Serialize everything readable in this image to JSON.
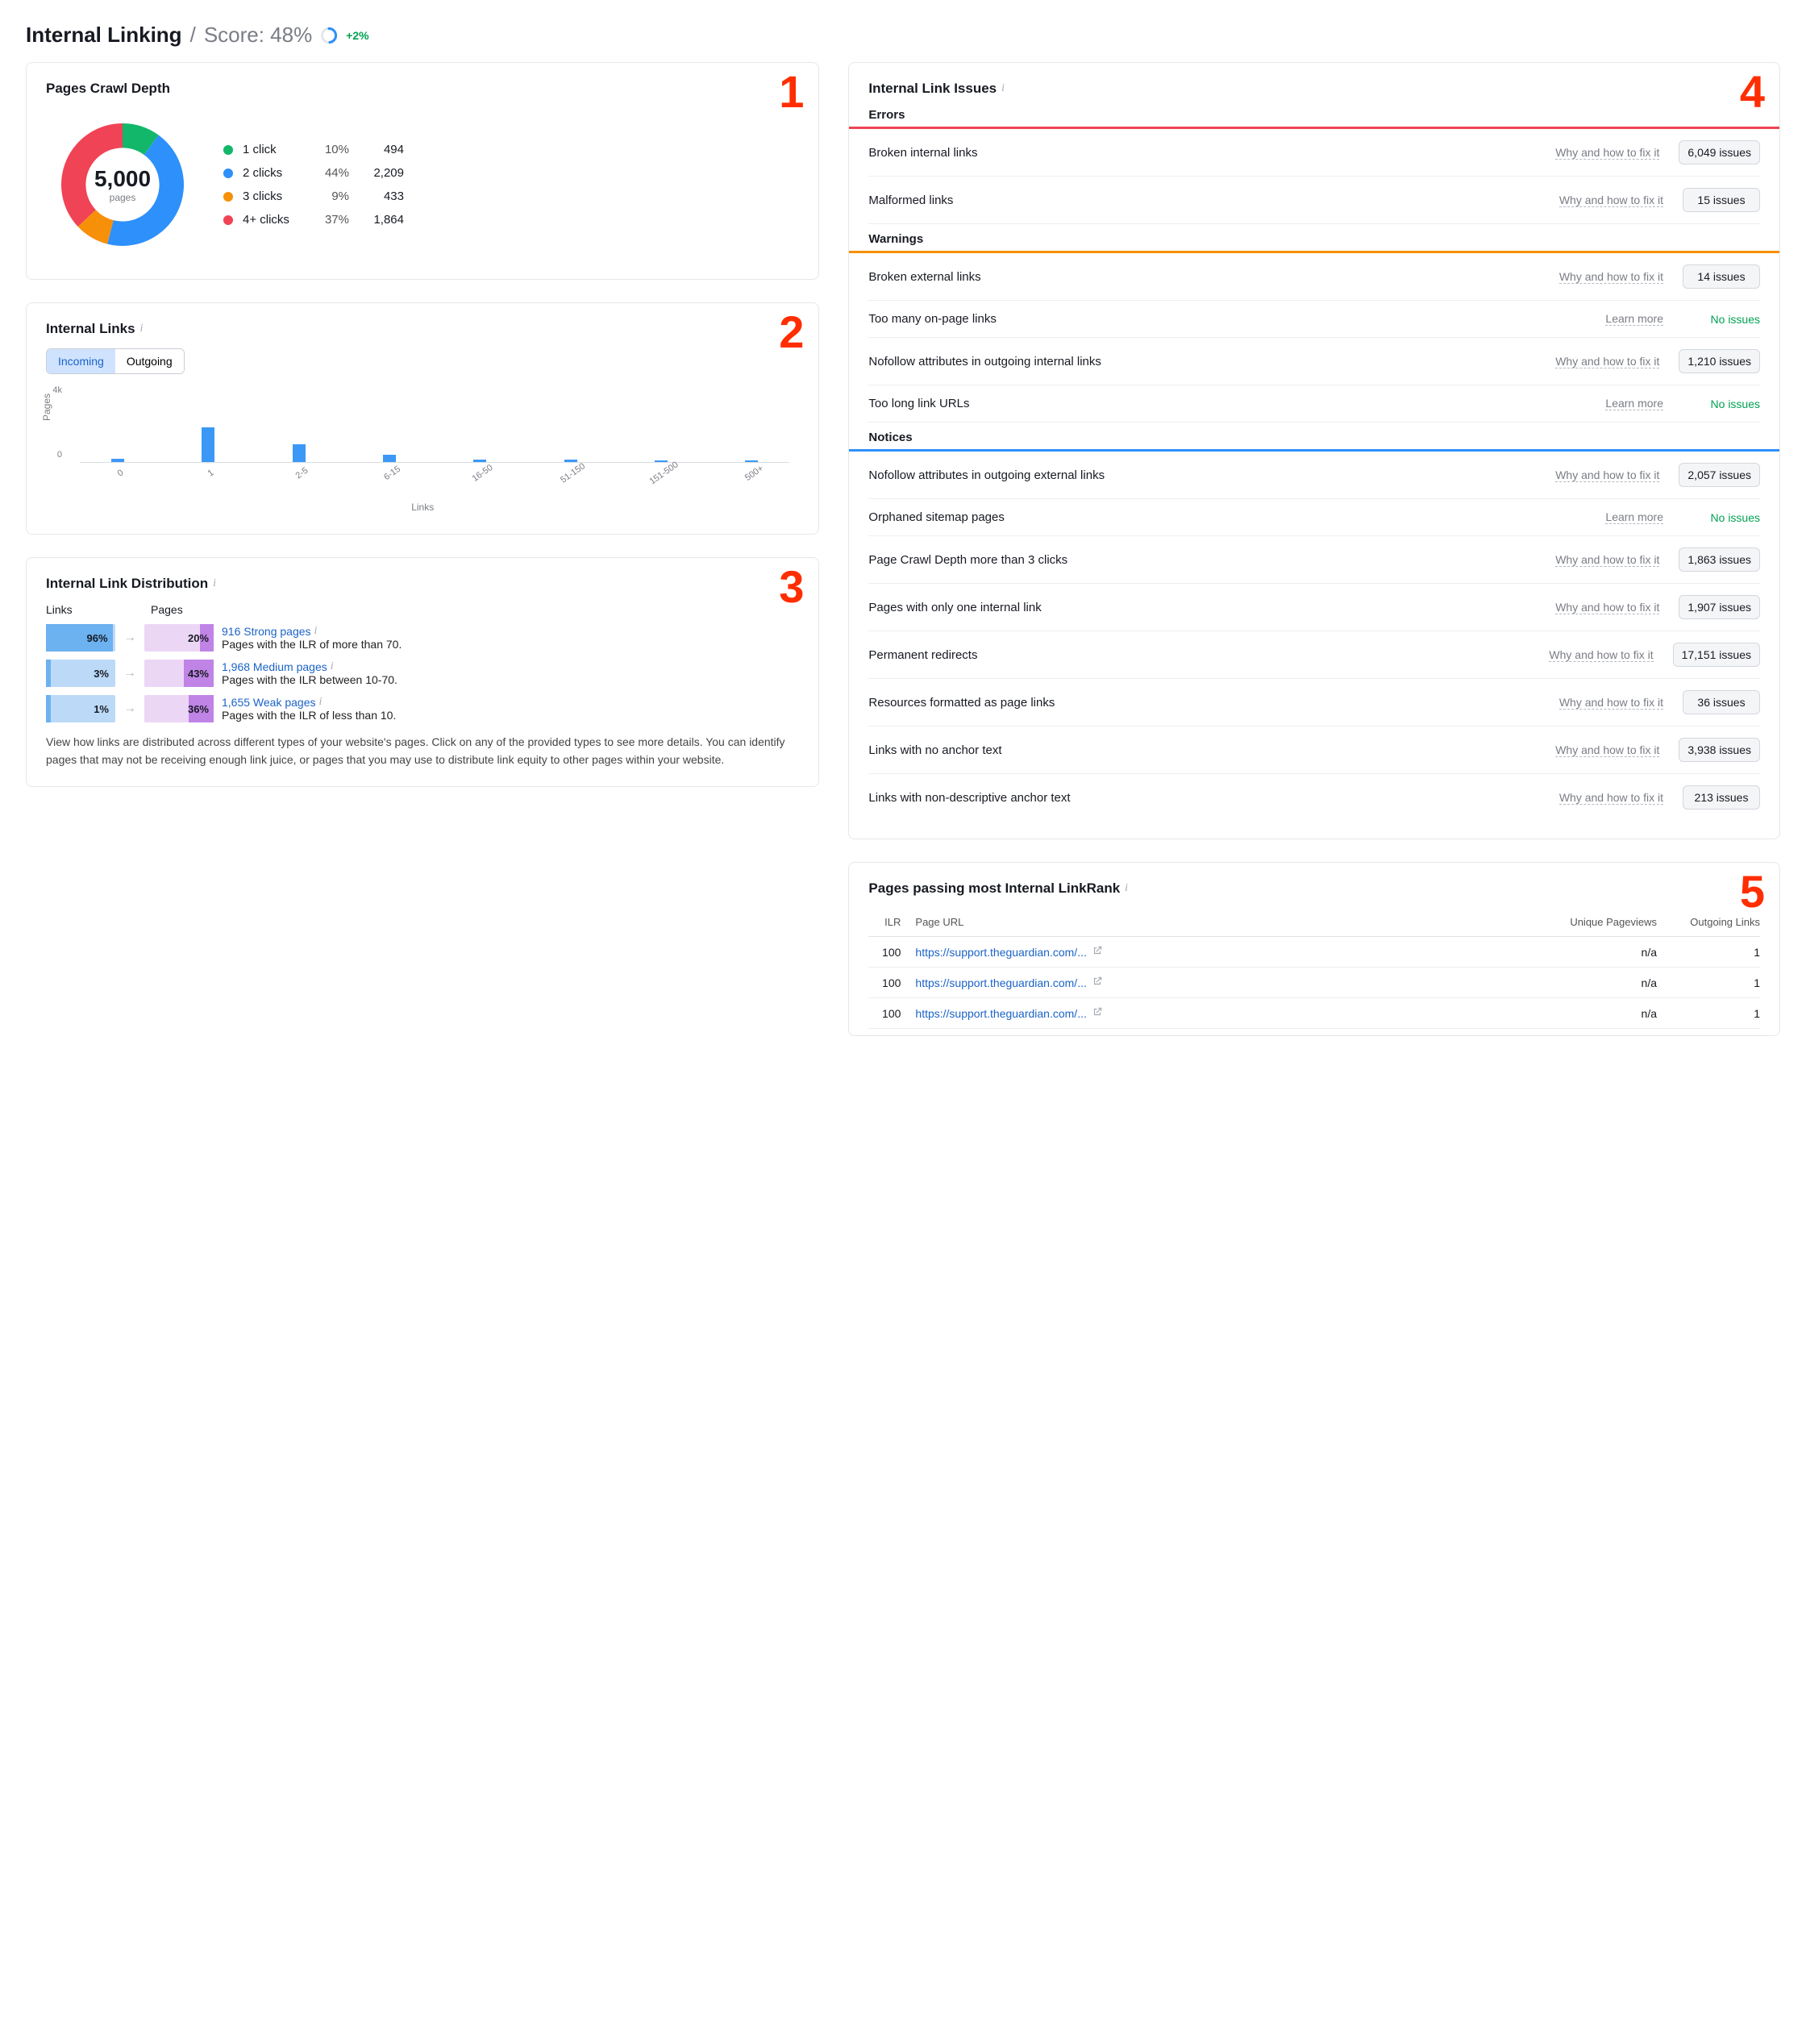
{
  "header": {
    "title": "Internal Linking",
    "sep": "/",
    "score_label": "Score: 48%",
    "delta": "+2%"
  },
  "markers": [
    "1",
    "2",
    "3",
    "4",
    "5"
  ],
  "crawl_depth": {
    "title": "Pages Crawl Depth",
    "total": "5,000",
    "total_sub": "pages",
    "rows": [
      {
        "label": "1 click",
        "pct": "10%",
        "count": "494",
        "color": "#12b76a"
      },
      {
        "label": "2 clicks",
        "pct": "44%",
        "count": "2,209",
        "color": "#2e90fa"
      },
      {
        "label": "3 clicks",
        "pct": "9%",
        "count": "433",
        "color": "#f79009"
      },
      {
        "label": "4+ clicks",
        "pct": "37%",
        "count": "1,864",
        "color": "#f04355"
      }
    ]
  },
  "chart_data": [
    {
      "type": "pie",
      "title": "Pages Crawl Depth",
      "total": 5000,
      "categories": [
        "1 click",
        "2 clicks",
        "3 clicks",
        "4+ clicks"
      ],
      "values": [
        494,
        2209,
        433,
        1864
      ],
      "percents": [
        10,
        44,
        9,
        37
      ],
      "colors": [
        "#12b76a",
        "#2e90fa",
        "#f79009",
        "#f04355"
      ]
    },
    {
      "type": "bar",
      "title": "Internal Links (Incoming)",
      "xlabel": "Links",
      "ylabel": "Pages",
      "ylim": [
        0,
        4000
      ],
      "categories": [
        "0",
        "1",
        "2-5",
        "6-15",
        "16-50",
        "51-150",
        "151-500",
        "500+"
      ],
      "values": [
        200,
        2000,
        1000,
        400,
        150,
        150,
        100,
        50
      ]
    }
  ],
  "internal_links": {
    "title": "Internal Links",
    "tabs": [
      "Incoming",
      "Outgoing"
    ],
    "ylabel": "Pages",
    "xlabel": "Links",
    "yticks": [
      "4k",
      "0"
    ]
  },
  "distribution": {
    "title": "Internal Link Distribution",
    "col_links": "Links",
    "col_pages": "Pages",
    "rows": [
      {
        "links_pct": "96%",
        "links_w": 96,
        "pages_pct": "20%",
        "pages_w": 20,
        "head": "916 Strong pages",
        "sub": "Pages with the ILR of more than 70."
      },
      {
        "links_pct": "3%",
        "links_w": 3,
        "pages_pct": "43%",
        "pages_w": 43,
        "head": "1,968 Medium pages",
        "sub": "Pages with the ILR between 10-70."
      },
      {
        "links_pct": "1%",
        "links_w": 1,
        "pages_pct": "36%",
        "pages_w": 36,
        "head": "1,655 Weak pages",
        "sub": "Pages with the ILR of less than 10."
      }
    ],
    "note": "View how links are distributed across different types of your website's pages. Click on any of the provided types to see more details. You can identify pages that may not be receiving enough link juice, or pages that you may use to distribute link equity to other pages within your website."
  },
  "issues": {
    "title": "Internal Link Issues",
    "sections": [
      {
        "name": "Errors",
        "color": "#f04355",
        "rows": [
          {
            "label": "Broken internal links",
            "link": "Why and how to fix it",
            "count": "6,049 issues"
          },
          {
            "label": "Malformed links",
            "link": "Why and how to fix it",
            "count": "15 issues"
          }
        ]
      },
      {
        "name": "Warnings",
        "color": "#f79009",
        "rows": [
          {
            "label": "Broken external links",
            "link": "Why and how to fix it",
            "count": "14 issues"
          },
          {
            "label": "Too many on-page links",
            "link": "Learn more",
            "none": "No issues"
          },
          {
            "label": "Nofollow attributes in outgoing internal links",
            "link": "Why and how to fix it",
            "count": "1,210 issues"
          },
          {
            "label": "Too long link URLs",
            "link": "Learn more",
            "none": "No issues"
          }
        ]
      },
      {
        "name": "Notices",
        "color": "#2e90fa",
        "rows": [
          {
            "label": "Nofollow attributes in outgoing external links",
            "link": "Why and how to fix it",
            "count": "2,057 issues"
          },
          {
            "label": "Orphaned sitemap pages",
            "link": "Learn more",
            "none": "No issues"
          },
          {
            "label": "Page Crawl Depth more than 3 clicks",
            "link": "Why and how to fix it",
            "count": "1,863 issues"
          },
          {
            "label": "Pages with only one internal link",
            "link": "Why and how to fix it",
            "count": "1,907 issues"
          },
          {
            "label": "Permanent redirects",
            "link": "Why and how to fix it",
            "count": "17,151 issues"
          },
          {
            "label": "Resources formatted as page links",
            "link": "Why and how to fix it",
            "count": "36 issues"
          },
          {
            "label": "Links with no anchor text",
            "link": "Why and how to fix it",
            "count": "3,938 issues"
          },
          {
            "label": "Links with non-descriptive anchor text",
            "link": "Why and how to fix it",
            "count": "213 issues"
          }
        ]
      }
    ]
  },
  "linkrank": {
    "title": "Pages passing most Internal LinkRank",
    "cols": [
      "ILR",
      "Page URL",
      "Unique Pageviews",
      "Outgoing Links"
    ],
    "rows": [
      {
        "ilr": "100",
        "url": "https://support.theguardian.com/...",
        "pv": "n/a",
        "out": "1"
      },
      {
        "ilr": "100",
        "url": "https://support.theguardian.com/...",
        "pv": "n/a",
        "out": "1"
      },
      {
        "ilr": "100",
        "url": "https://support.theguardian.com/...",
        "pv": "n/a",
        "out": "1"
      }
    ]
  }
}
